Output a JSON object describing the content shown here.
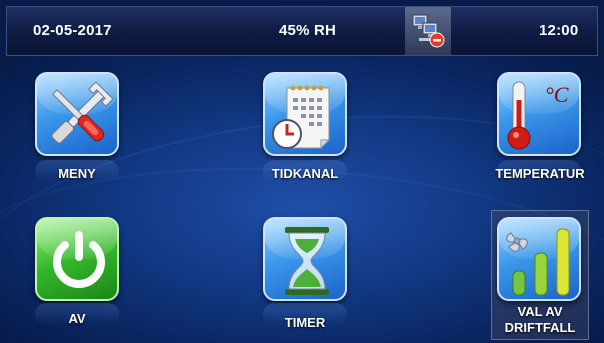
{
  "status_bar": {
    "date": "02-05-2017",
    "humidity": "45% RH",
    "time": "12:00",
    "network_icon": "network-disconnected-icon"
  },
  "tiles": [
    {
      "label": "MENY",
      "icon": "tools-icon"
    },
    {
      "label": "TIDKANAL",
      "icon": "calendar-clock-icon"
    },
    {
      "label": "TEMPERATUR",
      "icon": "thermometer-icon",
      "unit": "°C"
    },
    {
      "label": "AV",
      "icon": "power-icon"
    },
    {
      "label": "TIMER",
      "icon": "hourglass-icon"
    },
    {
      "label_line1": "VAL AV",
      "label_line2": "DRIFTFALL",
      "icon": "fan-levels-icon"
    }
  ],
  "colors": {
    "background": "#123a86",
    "tile_blue": "#3a97ea",
    "tile_green": "#33b62b",
    "statusbar": "#0f1c45"
  }
}
